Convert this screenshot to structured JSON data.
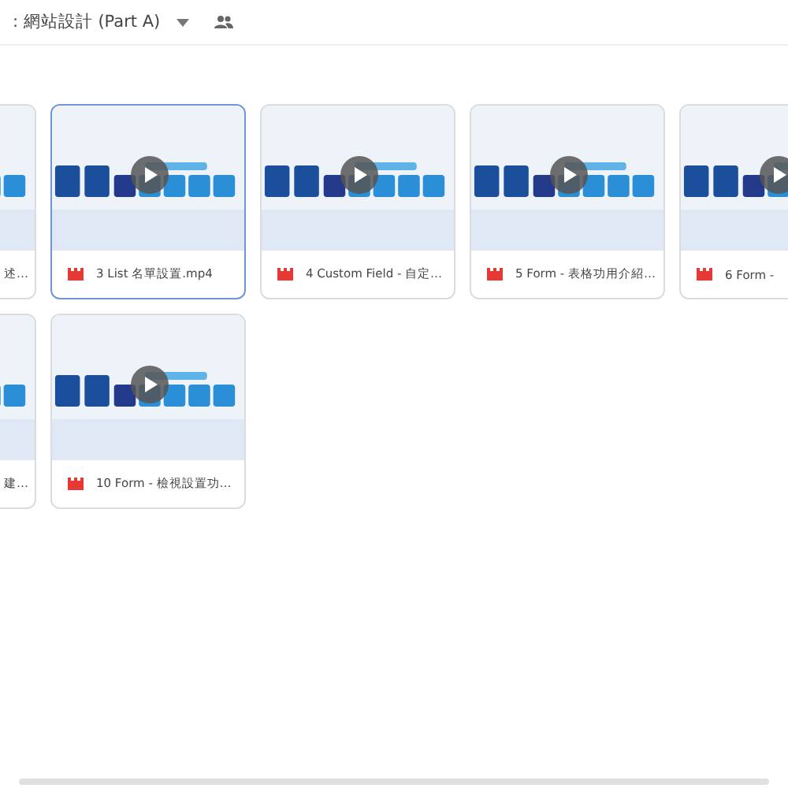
{
  "header": {
    "title": ": 網站設計 (Part A)"
  },
  "files": [
    {
      "name": "述…",
      "selected": false,
      "kind": "partial"
    },
    {
      "name": "3 List 名單設置.mp4",
      "selected": true,
      "kind": "video"
    },
    {
      "name": "4 Custom Field - 自定…",
      "selected": false,
      "kind": "video"
    },
    {
      "name": "5 Form - 表格功用介紹…",
      "selected": false,
      "kind": "video"
    },
    {
      "name": "6 Form -",
      "selected": false,
      "kind": "video"
    },
    {
      "name": "建…",
      "selected": false,
      "kind": "partial"
    },
    {
      "name": "10 Form - 檢視設置功…",
      "selected": false,
      "kind": "video"
    }
  ]
}
